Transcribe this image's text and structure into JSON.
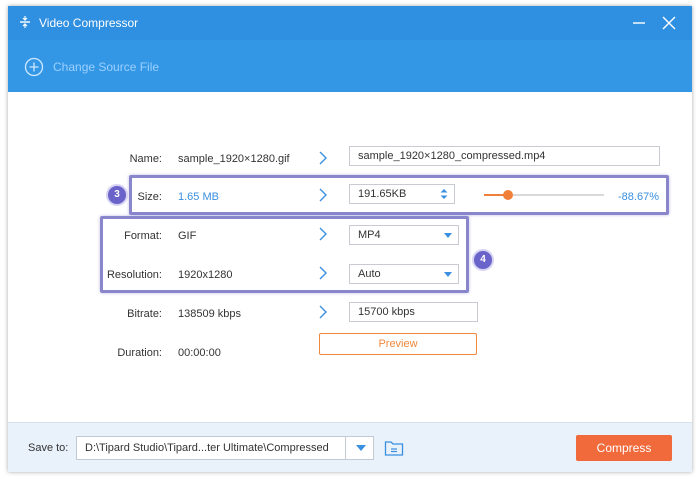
{
  "window": {
    "title": "Video Compressor"
  },
  "toolbar": {
    "change_source_label": "Change Source File"
  },
  "rows": {
    "name": {
      "label": "Name:",
      "source": "sample_1920×1280.gif",
      "output": "sample_1920×1280_compressed.mp4"
    },
    "size": {
      "label": "Size:",
      "source": "1.65 MB",
      "output": "191.65KB",
      "percent": "-88.67%",
      "slider_fraction": 0.2
    },
    "format": {
      "label": "Format:",
      "source": "GIF",
      "output": "MP4"
    },
    "resolution": {
      "label": "Resolution:",
      "source": "1920x1280",
      "output": "Auto"
    },
    "bitrate": {
      "label": "Bitrate:",
      "source": "138509 kbps",
      "output": "15700 kbps"
    },
    "duration": {
      "label": "Duration:",
      "source": "00:00:00"
    }
  },
  "preview_label": "Preview",
  "callouts": {
    "badge_size": "3",
    "badge_format": "4"
  },
  "footer": {
    "save_to_label": "Save to:",
    "path": "D:\\Tipard Studio\\Tipard...ter Ultimate\\Compressed",
    "compress_label": "Compress"
  },
  "colors": {
    "titlebar": "#2f8fe0",
    "toolbar": "#3397e6",
    "accent_blue": "#3a8fe0",
    "accent_orange": "#f06a3c",
    "callout": "#8a86cc"
  }
}
